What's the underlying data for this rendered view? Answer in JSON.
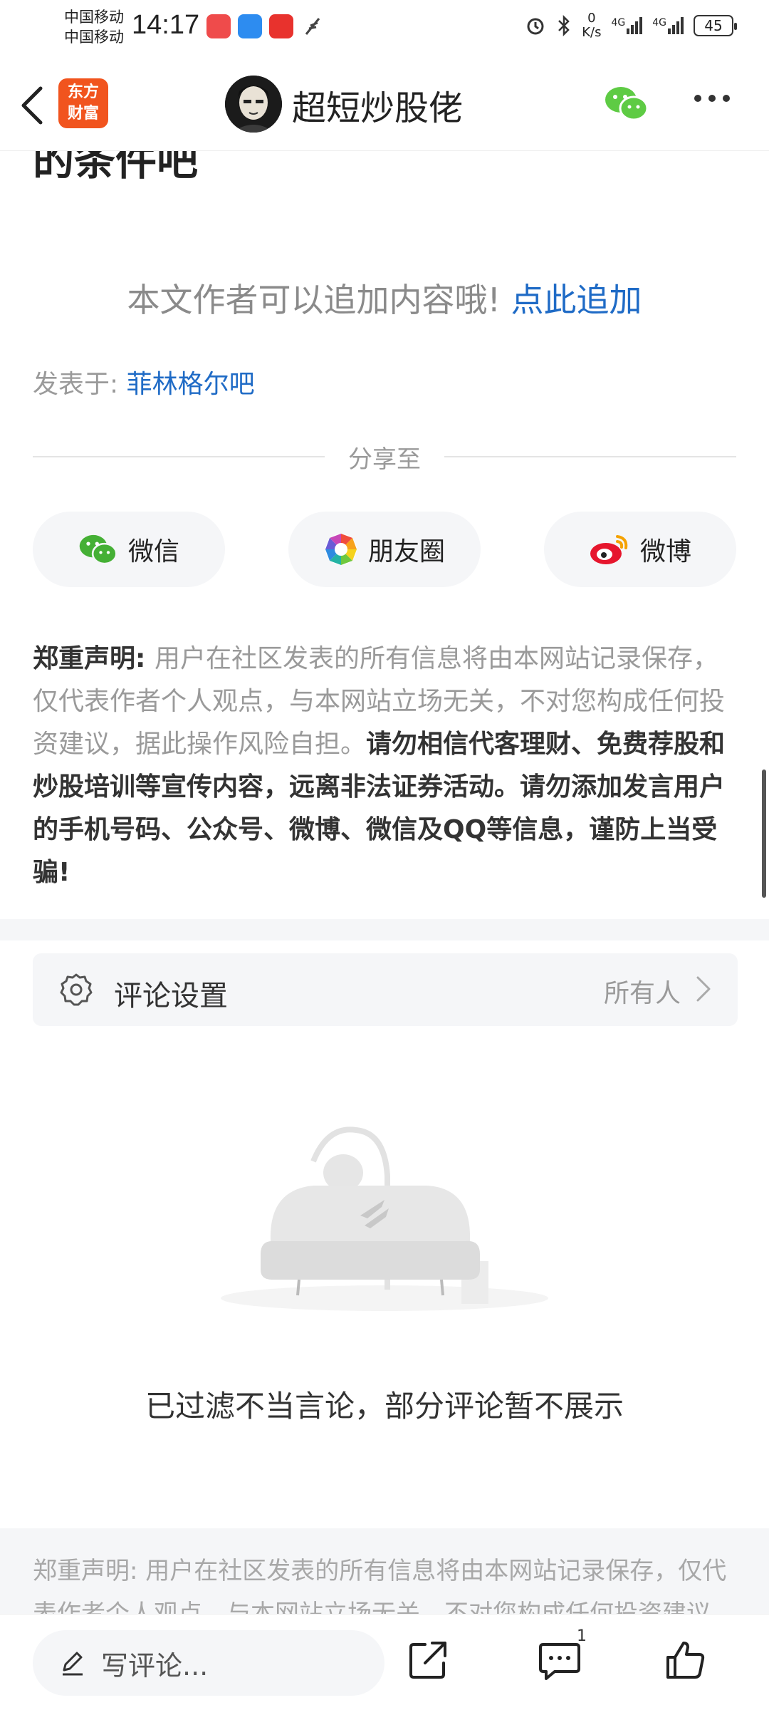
{
  "status_bar": {
    "carrier1": "中国移动",
    "carrier2": "中国移动",
    "time": "14:17",
    "net_speed_value": "0",
    "net_speed_unit": "K/s",
    "signal1": "4G",
    "signal2": "4G",
    "battery": "45"
  },
  "nav": {
    "logo_line1": "东方",
    "logo_line2": "财富",
    "title": "超短炒股佬"
  },
  "article": {
    "partial_text": "的条件吧",
    "append_prompt": "本文作者可以追加内容哦!",
    "append_link": "点此追加",
    "posted_label": "发表于: ",
    "posted_bar": "菲林格尔吧"
  },
  "share": {
    "label": "分享至",
    "buttons": [
      {
        "label": "微信",
        "icon": "wechat-icon"
      },
      {
        "label": "朋友圈",
        "icon": "moments-icon"
      },
      {
        "label": "微博",
        "icon": "weibo-icon"
      }
    ]
  },
  "disclaimer": {
    "title": "郑重声明: ",
    "normal": "用户在社区发表的所有信息将由本网站记录保存，仅代表作者个人观点，与本网站立场无关，不对您构成任何投资建议，据此操作风险自担。",
    "bold": "请勿相信代客理财、免费荐股和炒股培训等宣传内容，远离非法证券活动。请勿添加发言用户的手机号码、公众号、微博、微信及QQ等信息，谨防上当受骗!"
  },
  "comment_settings": {
    "label": "评论设置",
    "value": "所有人"
  },
  "comments": {
    "filter_note": "已过滤不当言论，部分评论暂不展示"
  },
  "footer": {
    "disclaimer": "郑重声明: 用户在社区发表的所有信息将由本网站记录保存，仅代表作者个人观点，与本网站立场无关，不对您构成任何投资建议，据此操作风险自担。"
  },
  "bottom_bar": {
    "input_placeholder": "写评论...",
    "comment_count": "1"
  }
}
